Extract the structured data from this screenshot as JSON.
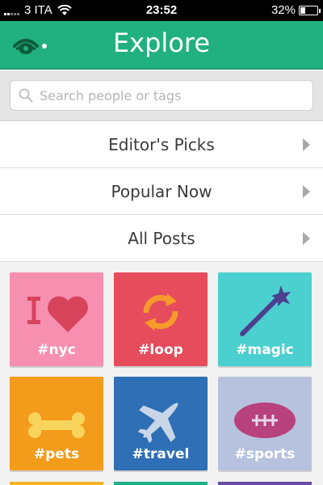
{
  "status": {
    "carrier": "3 ITA",
    "time": "23:52",
    "battery": "32%",
    "battery_level": 0.32,
    "signal_bars": 2
  },
  "header": {
    "title": "Explore",
    "logo_icon": "vine-eye-icon",
    "color": "#21b07f"
  },
  "search": {
    "placeholder": "Search people or tags",
    "icon": "search-icon"
  },
  "menu": [
    {
      "label": "Editor's Picks"
    },
    {
      "label": "Popular Now"
    },
    {
      "label": "All Posts"
    }
  ],
  "tags": [
    {
      "label": "#nyc",
      "icon": "i-love-icon",
      "color": "#f68fb0"
    },
    {
      "label": "#loop",
      "icon": "loop-arrows-icon",
      "color": "#e74c5c"
    },
    {
      "label": "#magic",
      "icon": "magic-wand-icon",
      "color": "#4ccfcf"
    },
    {
      "label": "#pets",
      "icon": "bone-icon",
      "color": "#f39c1c"
    },
    {
      "label": "#travel",
      "icon": "airplane-icon",
      "color": "#2e6fb5"
    },
    {
      "label": "#sports",
      "icon": "football-icon",
      "color": "#b6c2de"
    }
  ],
  "partial_row_colors": [
    "#f3b429",
    "#1fb08a",
    "#6a4ca0"
  ]
}
